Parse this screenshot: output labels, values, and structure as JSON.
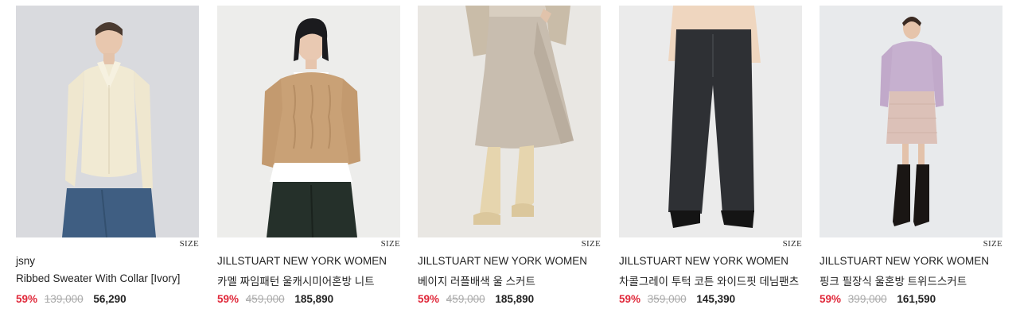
{
  "products": [
    {
      "brand": "jsny",
      "name": "Ribbed Sweater With Collar [Ivory]",
      "size_label": "SIZE",
      "discount": "59%",
      "original_price": "139,000",
      "sale_price": "56,290",
      "image_alt": "model in ivory ribbed collared cardigan and blue jeans"
    },
    {
      "brand": "JILLSTUART NEW YORK WOMEN",
      "name": "카멜 짜임패턴 울캐시미어혼방 니트",
      "size_label": "SIZE",
      "discount": "59%",
      "original_price": "459,000",
      "sale_price": "185,890",
      "image_alt": "model in camel cable knit sweater and dark green pants"
    },
    {
      "brand": "JILLSTUART NEW YORK WOMEN",
      "name": "베이지 러플배색 울 스커트",
      "size_label": "SIZE",
      "discount": "59%",
      "original_price": "459,000",
      "sale_price": "185,890",
      "image_alt": "beige wool skirt with cream knee boots"
    },
    {
      "brand": "JILLSTUART NEW YORK WOMEN",
      "name": "차콜그레이 투턱 코튼 와이드핏 데님팬츠",
      "size_label": "SIZE",
      "discount": "59%",
      "original_price": "359,000",
      "sale_price": "145,390",
      "image_alt": "charcoal wide fit denim pants with black ankle boots"
    },
    {
      "brand": "JILLSTUART NEW YORK WOMEN",
      "name": "핑크 필장식 울혼방 트위드스커트",
      "size_label": "SIZE",
      "discount": "59%",
      "original_price": "399,000",
      "sale_price": "161,590",
      "image_alt": "model in lilac sweater, pink tweed skirt and black boots"
    }
  ]
}
